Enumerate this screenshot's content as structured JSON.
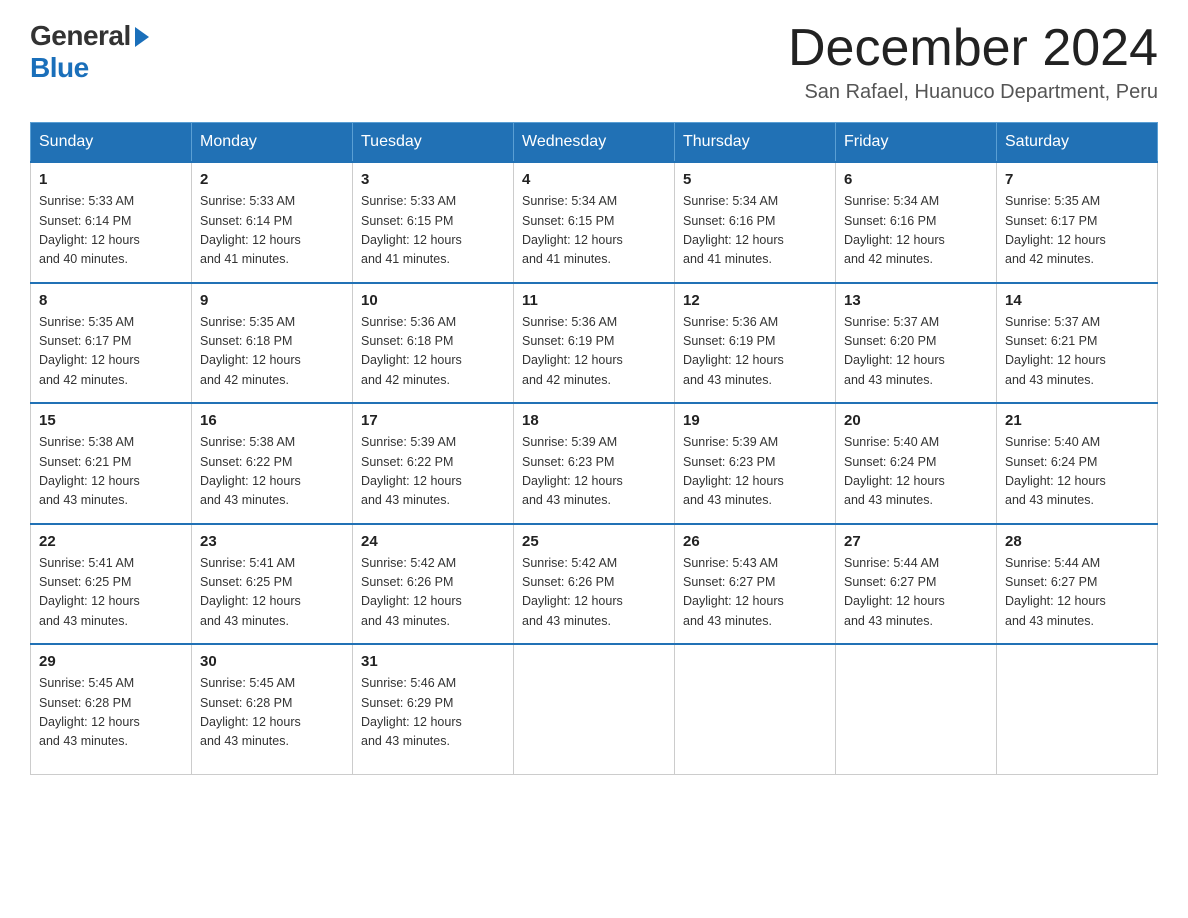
{
  "logo": {
    "general": "General",
    "blue": "Blue"
  },
  "title": "December 2024",
  "location": "San Rafael, Huanuco Department, Peru",
  "headers": [
    "Sunday",
    "Monday",
    "Tuesday",
    "Wednesday",
    "Thursday",
    "Friday",
    "Saturday"
  ],
  "weeks": [
    [
      {
        "day": "1",
        "sunrise": "5:33 AM",
        "sunset": "6:14 PM",
        "daylight": "12 hours and 40 minutes."
      },
      {
        "day": "2",
        "sunrise": "5:33 AM",
        "sunset": "6:14 PM",
        "daylight": "12 hours and 41 minutes."
      },
      {
        "day": "3",
        "sunrise": "5:33 AM",
        "sunset": "6:15 PM",
        "daylight": "12 hours and 41 minutes."
      },
      {
        "day": "4",
        "sunrise": "5:34 AM",
        "sunset": "6:15 PM",
        "daylight": "12 hours and 41 minutes."
      },
      {
        "day": "5",
        "sunrise": "5:34 AM",
        "sunset": "6:16 PM",
        "daylight": "12 hours and 41 minutes."
      },
      {
        "day": "6",
        "sunrise": "5:34 AM",
        "sunset": "6:16 PM",
        "daylight": "12 hours and 42 minutes."
      },
      {
        "day": "7",
        "sunrise": "5:35 AM",
        "sunset": "6:17 PM",
        "daylight": "12 hours and 42 minutes."
      }
    ],
    [
      {
        "day": "8",
        "sunrise": "5:35 AM",
        "sunset": "6:17 PM",
        "daylight": "12 hours and 42 minutes."
      },
      {
        "day": "9",
        "sunrise": "5:35 AM",
        "sunset": "6:18 PM",
        "daylight": "12 hours and 42 minutes."
      },
      {
        "day": "10",
        "sunrise": "5:36 AM",
        "sunset": "6:18 PM",
        "daylight": "12 hours and 42 minutes."
      },
      {
        "day": "11",
        "sunrise": "5:36 AM",
        "sunset": "6:19 PM",
        "daylight": "12 hours and 42 minutes."
      },
      {
        "day": "12",
        "sunrise": "5:36 AM",
        "sunset": "6:19 PM",
        "daylight": "12 hours and 43 minutes."
      },
      {
        "day": "13",
        "sunrise": "5:37 AM",
        "sunset": "6:20 PM",
        "daylight": "12 hours and 43 minutes."
      },
      {
        "day": "14",
        "sunrise": "5:37 AM",
        "sunset": "6:21 PM",
        "daylight": "12 hours and 43 minutes."
      }
    ],
    [
      {
        "day": "15",
        "sunrise": "5:38 AM",
        "sunset": "6:21 PM",
        "daylight": "12 hours and 43 minutes."
      },
      {
        "day": "16",
        "sunrise": "5:38 AM",
        "sunset": "6:22 PM",
        "daylight": "12 hours and 43 minutes."
      },
      {
        "day": "17",
        "sunrise": "5:39 AM",
        "sunset": "6:22 PM",
        "daylight": "12 hours and 43 minutes."
      },
      {
        "day": "18",
        "sunrise": "5:39 AM",
        "sunset": "6:23 PM",
        "daylight": "12 hours and 43 minutes."
      },
      {
        "day": "19",
        "sunrise": "5:39 AM",
        "sunset": "6:23 PM",
        "daylight": "12 hours and 43 minutes."
      },
      {
        "day": "20",
        "sunrise": "5:40 AM",
        "sunset": "6:24 PM",
        "daylight": "12 hours and 43 minutes."
      },
      {
        "day": "21",
        "sunrise": "5:40 AM",
        "sunset": "6:24 PM",
        "daylight": "12 hours and 43 minutes."
      }
    ],
    [
      {
        "day": "22",
        "sunrise": "5:41 AM",
        "sunset": "6:25 PM",
        "daylight": "12 hours and 43 minutes."
      },
      {
        "day": "23",
        "sunrise": "5:41 AM",
        "sunset": "6:25 PM",
        "daylight": "12 hours and 43 minutes."
      },
      {
        "day": "24",
        "sunrise": "5:42 AM",
        "sunset": "6:26 PM",
        "daylight": "12 hours and 43 minutes."
      },
      {
        "day": "25",
        "sunrise": "5:42 AM",
        "sunset": "6:26 PM",
        "daylight": "12 hours and 43 minutes."
      },
      {
        "day": "26",
        "sunrise": "5:43 AM",
        "sunset": "6:27 PM",
        "daylight": "12 hours and 43 minutes."
      },
      {
        "day": "27",
        "sunrise": "5:44 AM",
        "sunset": "6:27 PM",
        "daylight": "12 hours and 43 minutes."
      },
      {
        "day": "28",
        "sunrise": "5:44 AM",
        "sunset": "6:27 PM",
        "daylight": "12 hours and 43 minutes."
      }
    ],
    [
      {
        "day": "29",
        "sunrise": "5:45 AM",
        "sunset": "6:28 PM",
        "daylight": "12 hours and 43 minutes."
      },
      {
        "day": "30",
        "sunrise": "5:45 AM",
        "sunset": "6:28 PM",
        "daylight": "12 hours and 43 minutes."
      },
      {
        "day": "31",
        "sunrise": "5:46 AM",
        "sunset": "6:29 PM",
        "daylight": "12 hours and 43 minutes."
      },
      null,
      null,
      null,
      null
    ]
  ],
  "labels": {
    "sunrise": "Sunrise:",
    "sunset": "Sunset:",
    "daylight": "Daylight:"
  }
}
